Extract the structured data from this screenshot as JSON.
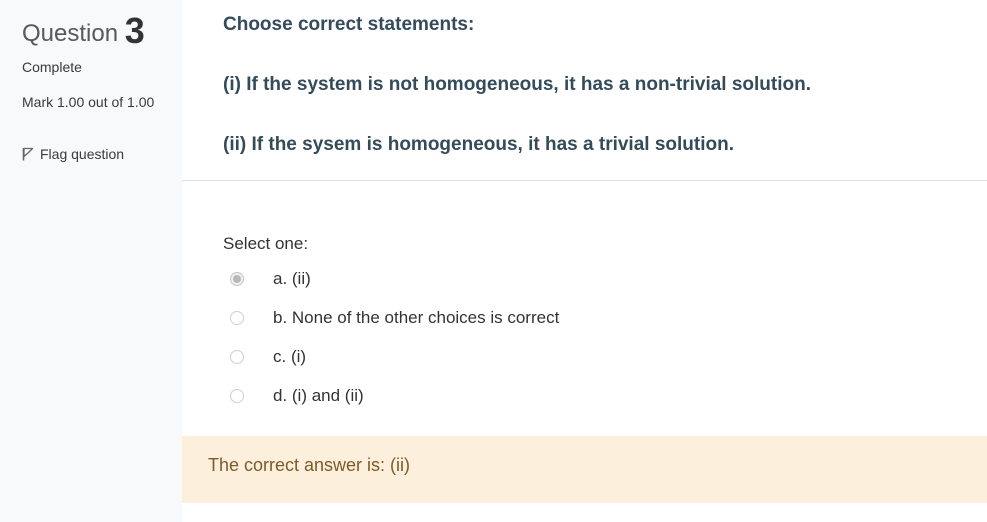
{
  "question_info": {
    "label": "Question",
    "number": "3",
    "state": "Complete",
    "grade": "Mark 1.00 out of 1.00",
    "flag_label": "Flag question"
  },
  "question": {
    "statements": [
      "Choose correct statements:",
      "(i) If the system is not homogeneous, it has a non-trivial solution.",
      "(ii) If the sysem is homogeneous, it has a trivial solution."
    ]
  },
  "answer": {
    "prompt": "Select one:",
    "options": [
      {
        "label": "a. (ii)",
        "selected": true
      },
      {
        "label": "b. None of the other choices is correct",
        "selected": false
      },
      {
        "label": "c. (i)",
        "selected": false
      },
      {
        "label": "d. (i) and (ii)",
        "selected": false
      }
    ]
  },
  "feedback": {
    "text": "The correct answer is: (ii)"
  },
  "colors": {
    "statement_text": "#344b5a",
    "feedback_bg": "#fcefdc",
    "feedback_text": "#7d5a29",
    "info_bg": "#f8f9fa"
  },
  "icons": {
    "flag": "flag-icon"
  }
}
